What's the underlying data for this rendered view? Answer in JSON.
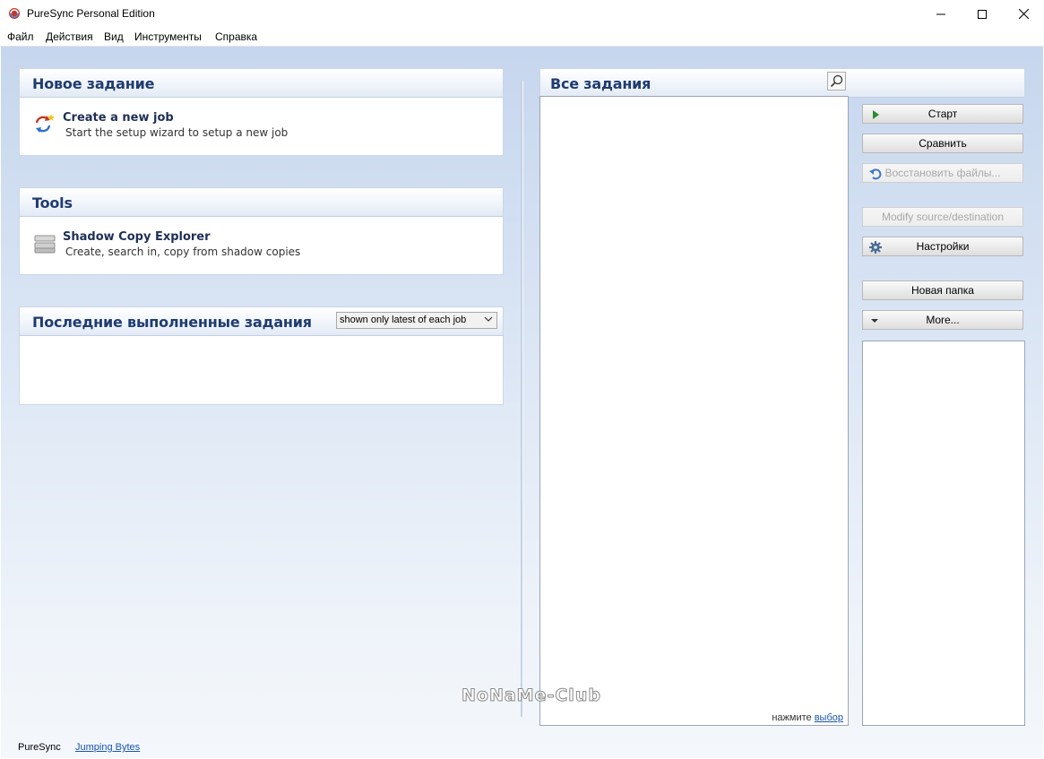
{
  "window": {
    "title": "PureSync Personal Edition"
  },
  "menu": [
    "Файл",
    "Действия",
    "Вид",
    "Инструменты",
    "Справка"
  ],
  "new_job": {
    "title": "Новое задание",
    "item_title": "Create a new job",
    "item_desc": "Start the setup wizard to setup a new job"
  },
  "tools": {
    "title": "Tools",
    "item_title": "Shadow Copy Explorer",
    "item_desc": "Create, search in, copy from shadow copies"
  },
  "recent": {
    "title": "Последние выполненные задания",
    "filter_value": "shown only latest of each job"
  },
  "all_jobs": {
    "title": "Все задания",
    "hint_text": "нажмите",
    "hint_link": "выбор"
  },
  "buttons": {
    "start": "Старт",
    "compare": "Сравнить",
    "restore": "Восстановить файлы...",
    "modify": "Modify source/destination",
    "settings": "Настройки",
    "new_folder": "Новая папка",
    "more": "More..."
  },
  "footer": {
    "app": "PureSync",
    "link": "Jumping Bytes"
  },
  "watermark": "NoNaMe-Club",
  "icons": [
    "app-icon",
    "minimize-icon",
    "maximize-icon",
    "close-icon",
    "new-job-icon",
    "shadow-copy-icon",
    "search-icon",
    "play-icon",
    "restore-icon",
    "gear-icon",
    "dropdown-arrow-icon",
    "chevron-down-icon"
  ]
}
